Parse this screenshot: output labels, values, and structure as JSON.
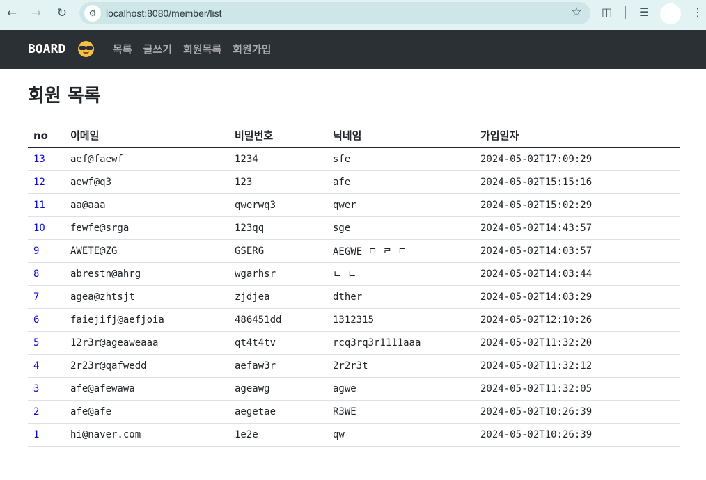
{
  "browser": {
    "url": "localhost:8080/member/list"
  },
  "navbar": {
    "brand": "BOARD",
    "links": [
      "목록",
      "글쓰기",
      "회원목록",
      "회원가입"
    ]
  },
  "page": {
    "title": "회원 목록"
  },
  "table": {
    "headers": [
      "no",
      "이메일",
      "비밀번호",
      "닉네임",
      "가입일자"
    ],
    "rows": [
      [
        "13",
        "aef@faewf",
        "1234",
        "sfe",
        "2024-05-02T17:09:29"
      ],
      [
        "12",
        "aewf@q3",
        "123",
        "afe",
        "2024-05-02T15:15:16"
      ],
      [
        "11",
        "aa@aaa",
        "qwerwq3",
        "qwer",
        "2024-05-02T15:02:29"
      ],
      [
        "10",
        "fewfe@srga",
        "123qq",
        "sge",
        "2024-05-02T14:43:57"
      ],
      [
        "9",
        "AWETE@ZG",
        "GSERG",
        "AEGWE ㅁ ㄹ ㄷ",
        "2024-05-02T14:03:57"
      ],
      [
        "8",
        "abrestn@ahrg",
        "wgarhsr",
        "ㄴ ㄴ",
        "2024-05-02T14:03:44"
      ],
      [
        "7",
        "agea@zhtsjt",
        "zjdjea",
        "dther",
        "2024-05-02T14:03:29"
      ],
      [
        "6",
        "faiejifj@aefjoia",
        "486451dd",
        "1312315",
        "2024-05-02T12:10:26"
      ],
      [
        "5",
        "12r3r@ageaweaaa",
        "qt4t4tv",
        "rcq3rq3r1111aaa",
        "2024-05-02T11:32:20"
      ],
      [
        "4",
        "2r23r@qafwedd",
        "aefaw3r",
        "2r2r3t",
        "2024-05-02T11:32:12"
      ],
      [
        "3",
        "afe@afewawa",
        "ageawg",
        "agwe",
        "2024-05-02T11:32:05"
      ],
      [
        "2",
        "afe@afe",
        "aegetae",
        "R3WE",
        "2024-05-02T10:26:39"
      ],
      [
        "1",
        "hi@naver.com",
        "1e2e",
        "qw",
        "2024-05-02T10:26:39"
      ]
    ]
  }
}
